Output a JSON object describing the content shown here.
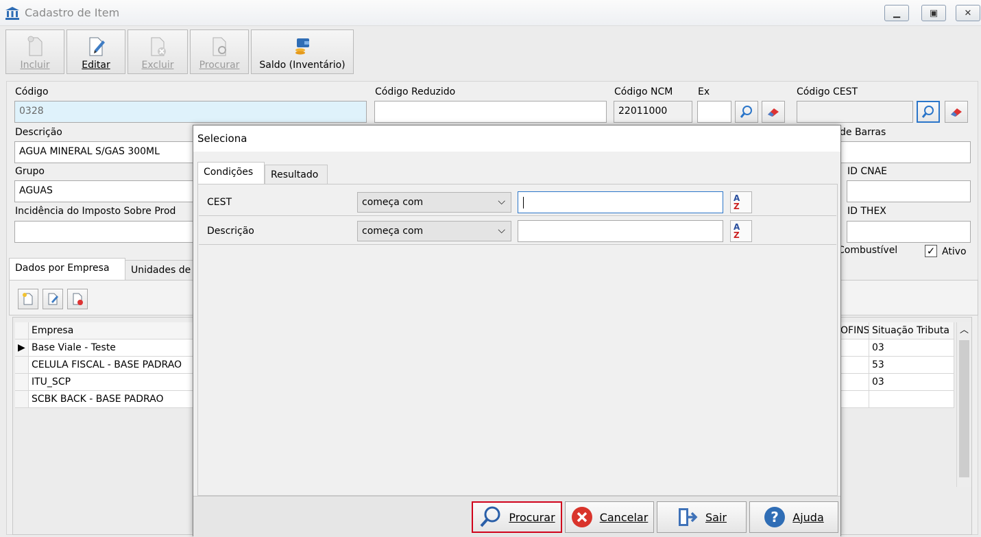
{
  "window": {
    "title": "Cadastro de Item"
  },
  "toolbar": {
    "incluir": "Incluir",
    "editar": "Editar",
    "excluir": "Excluir",
    "procurar": "Procurar",
    "saldo": "Saldo (Inventário)"
  },
  "form": {
    "codigo_label": "Código",
    "codigo_value": "0328",
    "codigo_reduzido_label": "Código Reduzido",
    "codigo_reduzido_value": "",
    "ncm_label": "Código NCM",
    "ncm_value": "22011000",
    "ex_label": "Ex",
    "ex_value": "",
    "cest_label": "Código CEST",
    "cest_value": "",
    "descricao_label": "Descrição",
    "descricao_value": "AGUA MINERAL S/GAS 300ML",
    "barras_label": "de Barras",
    "grupo_label": "Grupo",
    "grupo_value": "AGUAS",
    "cnae_label": "ID CNAE",
    "incidencia_label": "Incidência do Imposto Sobre Prod",
    "thex_label": "ID THEX",
    "combustivel_label": "Combustível",
    "ativo_label": "Ativo",
    "ativo_checked": "✓"
  },
  "tabs": {
    "dados": "Dados por Empresa",
    "unidades": "Unidades de"
  },
  "grid": {
    "col_empresa": "Empresa",
    "col_cofins": "OFINS",
    "col_situacao": "Situação Tributa",
    "rows": [
      {
        "empresa": "Base Viale - Teste",
        "situacao": "03"
      },
      {
        "empresa": "CELULA FISCAL - BASE PADRAO",
        "situacao": "53"
      },
      {
        "empresa": "ITU_SCP",
        "situacao": "03"
      },
      {
        "empresa": "SCBK BACK - BASE PADRAO",
        "situacao": ""
      }
    ]
  },
  "dialog": {
    "title": "Seleciona",
    "tab_condicoes": "Condições",
    "tab_resultado": "Resultado",
    "rows": [
      {
        "field": "CEST",
        "operator": "começa com",
        "value": ""
      },
      {
        "field": "Descrição",
        "operator": "começa com",
        "value": ""
      }
    ],
    "btn_procurar": "Procurar",
    "btn_cancelar": "Cancelar",
    "btn_sair": "Sair",
    "btn_ajuda": "Ajuda"
  },
  "colors": {
    "accent": "#2a75c9",
    "highlight_border": "#d0021b"
  }
}
